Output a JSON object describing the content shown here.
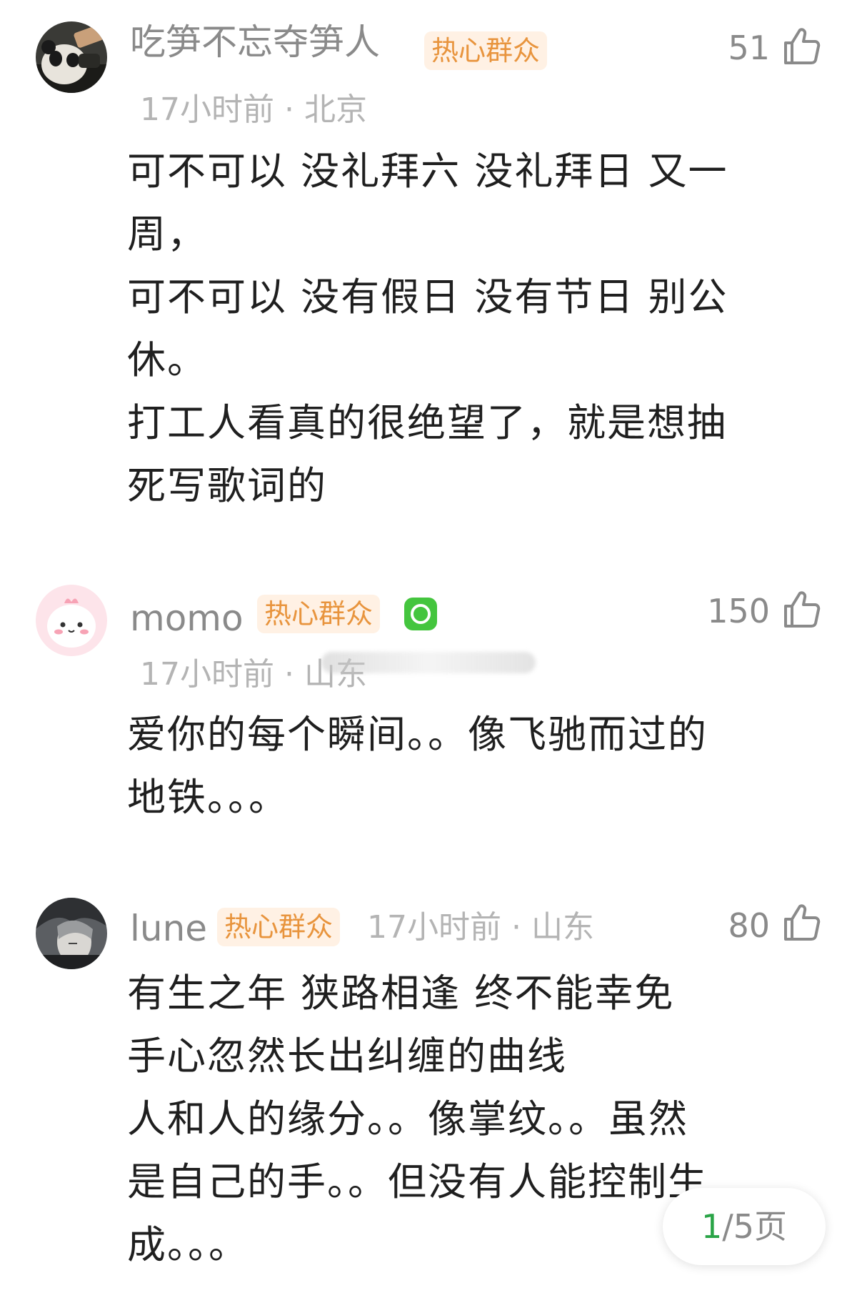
{
  "comments": [
    {
      "username": "吃笋不忘夺笋人",
      "badge": "热心群众",
      "time": "17小时前",
      "location": "北京",
      "separator": "·",
      "likes": "51",
      "lines": [
        "可不可以 没礼拜六 没礼拜日 又一",
        "周，",
        "可不可以 没有假日 没有节日 别公",
        "休。",
        "打工人看真的很绝望了，就是想抽",
        "死写歌词的"
      ]
    },
    {
      "username": "momo",
      "badge": "热心群众",
      "time": "17小时前",
      "location": "山东",
      "separator": "·",
      "likes": "150",
      "lines": [
        "爱你的每个瞬间。。像飞驰而过的",
        "地铁。。。"
      ]
    },
    {
      "username": "lune",
      "badge": "热心群众",
      "time": "17小时前",
      "location": "山东",
      "separator": "·",
      "likes": "80",
      "lines": [
        "有生之年 狭路相逢 终不能幸免",
        "手心忽然长出纠缠的曲线",
        "人和人的缘分。。像掌纹。。虽然",
        "是自己的手。。但没有人能控制生",
        "成。。。"
      ]
    }
  ],
  "pager": {
    "current": "1",
    "total": "/5页"
  },
  "colors": {
    "badge_text": "#e8943d",
    "badge_bg": "#fff1e4",
    "pager_current": "#2aa447",
    "vip_green": "#44c53e"
  },
  "icons": {
    "like": "thumbs-up-icon",
    "vip": "vip-badge-icon"
  }
}
